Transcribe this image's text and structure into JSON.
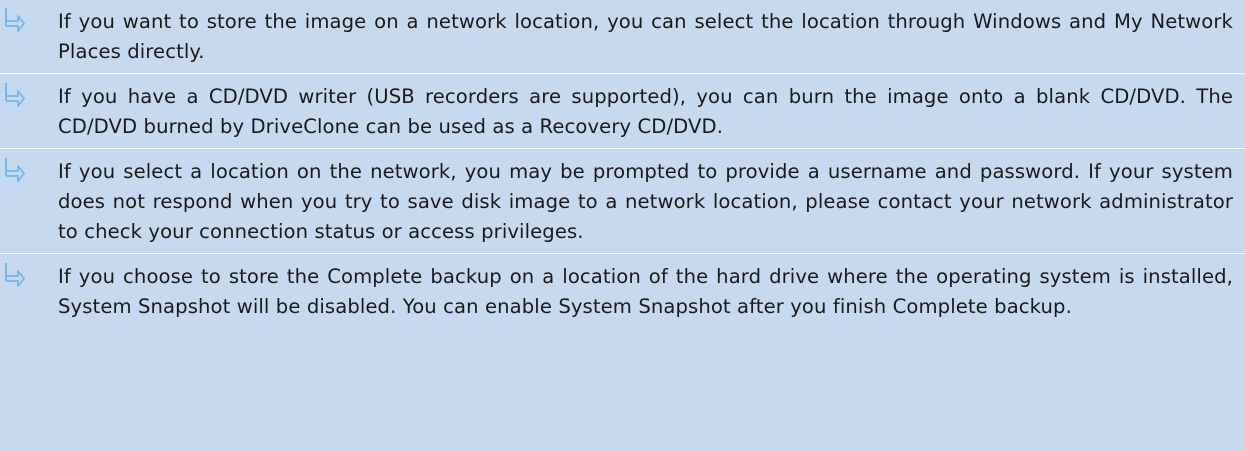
{
  "colors": {
    "background": "#c6d9ee",
    "icon": "#6fb7ee",
    "divider": "#ffffff",
    "text": "#1a1a1a"
  },
  "notes": [
    {
      "icon": "turn-right-arrow-icon",
      "text": "If you want to store the image on a network location, you can select the location through Windows and My Network Places directly."
    },
    {
      "icon": "turn-right-arrow-icon",
      "text": "If you have a CD/DVD writer (USB recorders are supported), you can burn the image onto a blank CD/DVD. The CD/DVD burned by DriveClone can be used as a Recovery CD/DVD."
    },
    {
      "icon": "turn-right-arrow-icon",
      "text": "If you select a location on the network, you may be prompted to provide a username and password. If your system does not respond when you try to save disk image to a network location, please contact your network administrator to check your connection status or access privileges."
    },
    {
      "icon": "turn-right-arrow-icon",
      "text": "If you choose to store the Complete backup on a location of the hard drive where the operating system is installed, System Snapshot will be disabled. You can enable System Snapshot after you finish Complete backup."
    }
  ]
}
